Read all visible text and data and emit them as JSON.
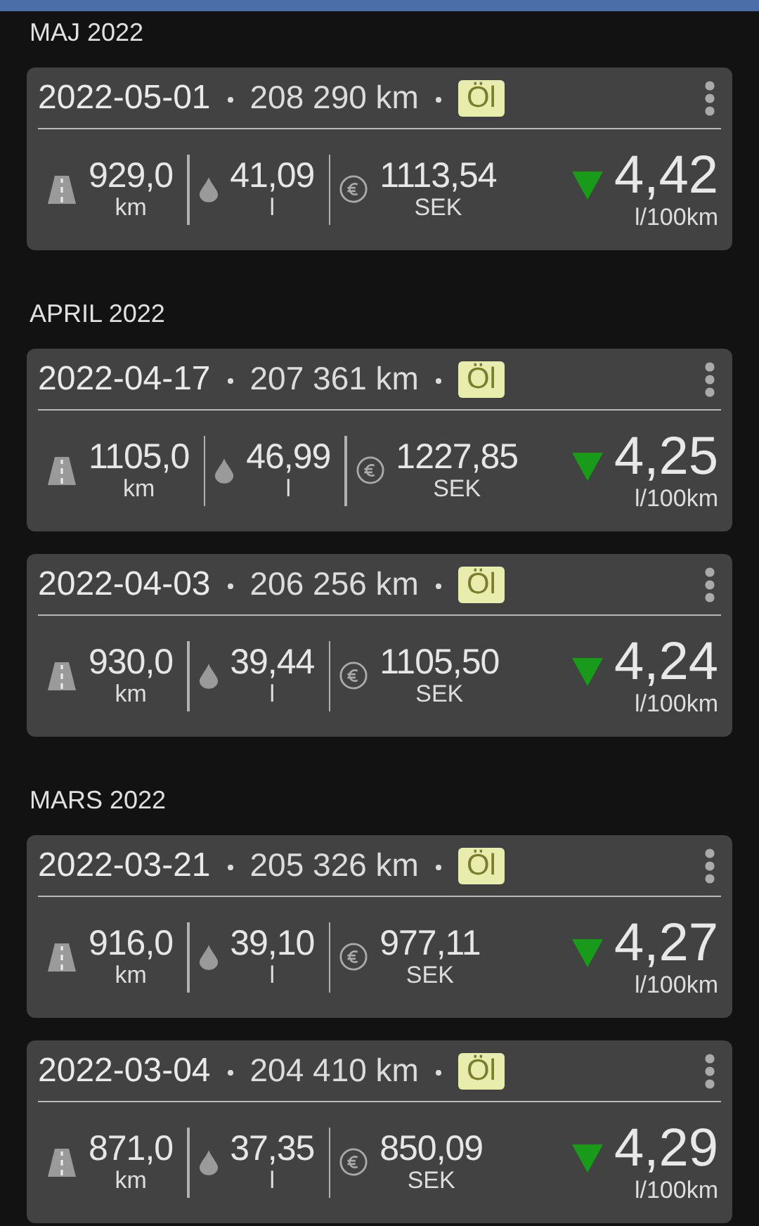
{
  "months": [
    {
      "label": "MAJ 2022",
      "entries": [
        {
          "date": "2022-05-01",
          "odometer": "208 290 km",
          "tag": "Öl",
          "distance": "929,0",
          "distance_unit": "km",
          "volume": "41,09",
          "volume_unit": "l",
          "cost": "1113,54",
          "currency": "SEK",
          "decreased": true,
          "consumption": "4,42",
          "consumption_unit": "l/100km"
        }
      ]
    },
    {
      "label": "APRIL 2022",
      "entries": [
        {
          "date": "2022-04-17",
          "odometer": "207 361 km",
          "tag": "Öl",
          "distance": "1105,0",
          "distance_unit": "km",
          "volume": "46,99",
          "volume_unit": "l",
          "cost": "1227,85",
          "currency": "SEK",
          "decreased": true,
          "consumption": "4,25",
          "consumption_unit": "l/100km"
        },
        {
          "date": "2022-04-03",
          "odometer": "206 256 km",
          "tag": "Öl",
          "distance": "930,0",
          "distance_unit": "km",
          "volume": "39,44",
          "volume_unit": "l",
          "cost": "1105,50",
          "currency": "SEK",
          "decreased": true,
          "consumption": "4,24",
          "consumption_unit": "l/100km"
        }
      ]
    },
    {
      "label": "MARS 2022",
      "entries": [
        {
          "date": "2022-03-21",
          "odometer": "205 326 km",
          "tag": "Öl",
          "distance": "916,0",
          "distance_unit": "km",
          "volume": "39,10",
          "volume_unit": "l",
          "cost": "977,11",
          "currency": "SEK",
          "decreased": true,
          "consumption": "4,27",
          "consumption_unit": "l/100km"
        },
        {
          "date": "2022-03-04",
          "odometer": "204 410 km",
          "tag": "Öl",
          "distance": "871,0",
          "distance_unit": "km",
          "volume": "37,35",
          "volume_unit": "l",
          "cost": "850,09",
          "currency": "SEK",
          "decreased": true,
          "consumption": "4,29",
          "consumption_unit": "l/100km"
        }
      ]
    }
  ]
}
